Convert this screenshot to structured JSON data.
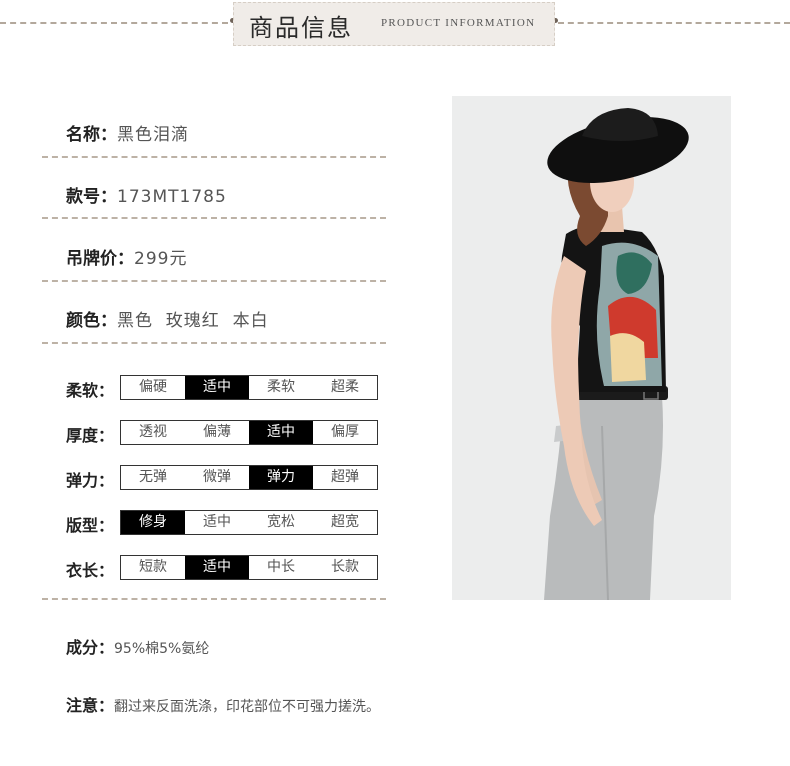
{
  "header": {
    "title": "商品信息",
    "subtitle": "PRODUCT INFORMATION"
  },
  "info": [
    {
      "label": "名称：",
      "value": "黑色泪滴"
    },
    {
      "label": "款号：",
      "value": "173MT1785"
    },
    {
      "label": "吊牌价：",
      "value": "299元"
    },
    {
      "label": "颜色：",
      "value": "黑色  玫瑰红  本白"
    }
  ],
  "attributes": [
    {
      "label": "柔软：",
      "options": [
        "偏硬",
        "适中",
        "柔软",
        "超柔"
      ],
      "selected": "适中"
    },
    {
      "label": "厚度：",
      "options": [
        "透视",
        "偏薄",
        "适中",
        "偏厚"
      ],
      "selected": "适中"
    },
    {
      "label": "弹力：",
      "options": [
        "无弹",
        "微弹",
        "弹力",
        "超弹"
      ],
      "selected": "弹力"
    },
    {
      "label": "版型：",
      "options": [
        "修身",
        "适中",
        "宽松",
        "超宽"
      ],
      "selected": "修身"
    },
    {
      "label": "衣长：",
      "options": [
        "短款",
        "适中",
        "中长",
        "长款"
      ],
      "selected": "适中"
    }
  ],
  "composition": {
    "label": "成分：",
    "value": "95%棉5%氨纶"
  },
  "notice": {
    "label": "注意：",
    "value": "翻过来反面洗涤，印花部位不可强力搓洗。"
  },
  "colors": {
    "divider": "#bdb2a6",
    "header_bg": "#f0ece8",
    "selected_bg": "#000000",
    "selected_text": "#ffffff"
  }
}
